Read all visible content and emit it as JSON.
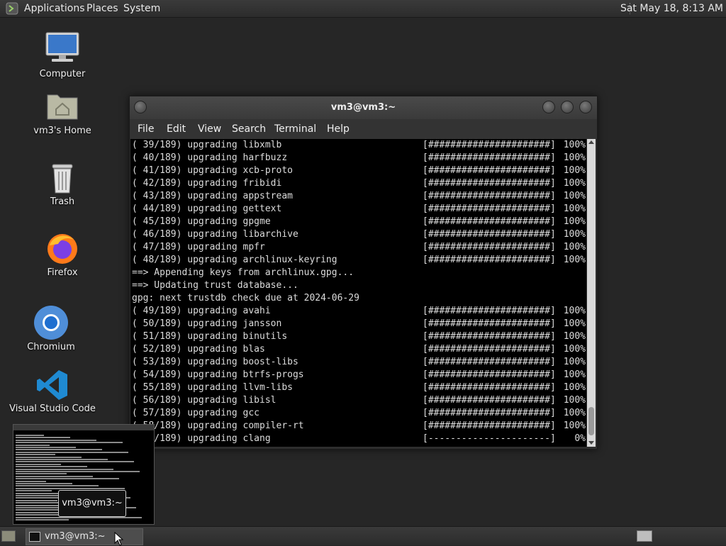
{
  "top_panel": {
    "menus": [
      "Applications",
      "Places",
      "System"
    ],
    "clock": "Sat May 18,  8:13 AM"
  },
  "desktop": {
    "icons": [
      {
        "label": "Computer",
        "icon": "computer-icon"
      },
      {
        "label": "vm3's Home",
        "icon": "home-folder-icon"
      },
      {
        "label": "Trash",
        "icon": "trash-icon"
      },
      {
        "label": "Firefox",
        "icon": "firefox-icon"
      },
      {
        "label": "Chromium",
        "icon": "chromium-icon"
      },
      {
        "label": "Visual Studio Code",
        "icon": "vscode-icon"
      }
    ]
  },
  "terminal": {
    "title": "vm3@vm3:~",
    "menu": [
      "File",
      "Edit",
      "View",
      "Search",
      "Terminal",
      "Help"
    ],
    "lines": [
      {
        "text": "( 39/189) upgrading libxmlb",
        "bar": "[######################]",
        "pct": "100%"
      },
      {
        "text": "( 40/189) upgrading harfbuzz",
        "bar": "[######################]",
        "pct": "100%"
      },
      {
        "text": "( 41/189) upgrading xcb-proto",
        "bar": "[######################]",
        "pct": "100%"
      },
      {
        "text": "( 42/189) upgrading fribidi",
        "bar": "[######################]",
        "pct": "100%"
      },
      {
        "text": "( 43/189) upgrading appstream",
        "bar": "[######################]",
        "pct": "100%"
      },
      {
        "text": "( 44/189) upgrading gettext",
        "bar": "[######################]",
        "pct": "100%"
      },
      {
        "text": "( 45/189) upgrading gpgme",
        "bar": "[######################]",
        "pct": "100%"
      },
      {
        "text": "( 46/189) upgrading libarchive",
        "bar": "[######################]",
        "pct": "100%"
      },
      {
        "text": "( 47/189) upgrading mpfr",
        "bar": "[######################]",
        "pct": "100%"
      },
      {
        "text": "( 48/189) upgrading archlinux-keyring",
        "bar": "[######################]",
        "pct": "100%"
      },
      {
        "text": "==> Appending keys from archlinux.gpg...",
        "bar": "",
        "pct": ""
      },
      {
        "text": "==> Updating trust database...",
        "bar": "",
        "pct": ""
      },
      {
        "text": "gpg: next trustdb check due at 2024-06-29",
        "bar": "",
        "pct": ""
      },
      {
        "text": "( 49/189) upgrading avahi",
        "bar": "[######################]",
        "pct": "100%"
      },
      {
        "text": "( 50/189) upgrading jansson",
        "bar": "[######################]",
        "pct": "100%"
      },
      {
        "text": "( 51/189) upgrading binutils",
        "bar": "[######################]",
        "pct": "100%"
      },
      {
        "text": "( 52/189) upgrading blas",
        "bar": "[######################]",
        "pct": "100%"
      },
      {
        "text": "( 53/189) upgrading boost-libs",
        "bar": "[######################]",
        "pct": "100%"
      },
      {
        "text": "( 54/189) upgrading btrfs-progs",
        "bar": "[######################]",
        "pct": "100%"
      },
      {
        "text": "( 55/189) upgrading llvm-libs",
        "bar": "[######################]",
        "pct": "100%"
      },
      {
        "text": "( 56/189) upgrading libisl",
        "bar": "[######################]",
        "pct": "100%"
      },
      {
        "text": "( 57/189) upgrading gcc",
        "bar": "[######################]",
        "pct": "100%"
      },
      {
        "text": "( 58/189) upgrading compiler-rt",
        "bar": "[######################]",
        "pct": "100%"
      },
      {
        "text": "( 59/189) upgrading clang",
        "bar": "[----------------------]",
        "pct": "0%"
      }
    ]
  },
  "preview": {
    "tooltip": "vm3@vm3:~"
  },
  "taskbar": {
    "window_button": "vm3@vm3:~"
  }
}
